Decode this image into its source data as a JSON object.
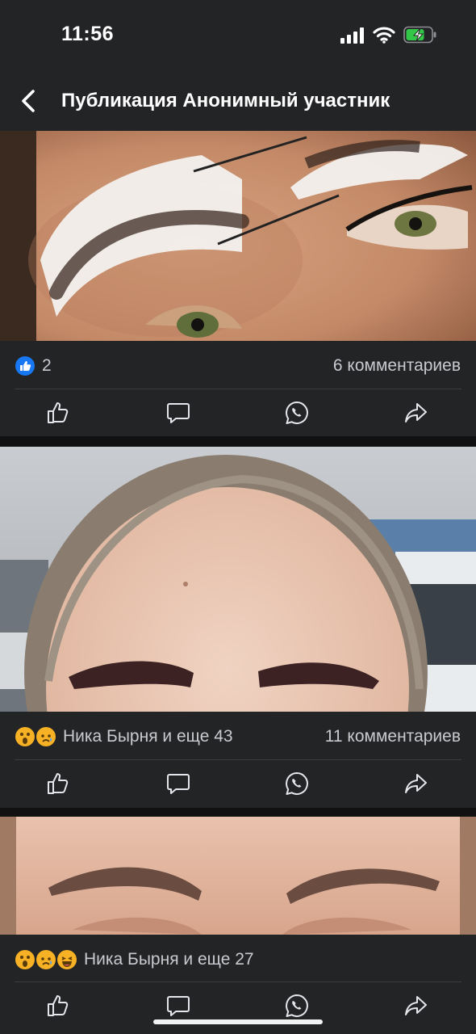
{
  "status_bar": {
    "time": "11:56"
  },
  "header": {
    "title": "Публикация Анонимный участник"
  },
  "posts": [
    {
      "reactions_text": "2",
      "comments": "6 комментариев"
    },
    {
      "reactions_text": "Ника Бырня и еще 43",
      "comments": "11 комментариев"
    },
    {
      "reactions_text": "Ника Бырня и еще 27",
      "comments": ""
    }
  ],
  "colors": {
    "bar_bg": "#232426",
    "page_bg": "#111112",
    "like_blue": "#1877f2"
  },
  "icons": [
    "back-icon",
    "like-icon",
    "comment-icon",
    "whatsapp-icon",
    "share-icon"
  ]
}
